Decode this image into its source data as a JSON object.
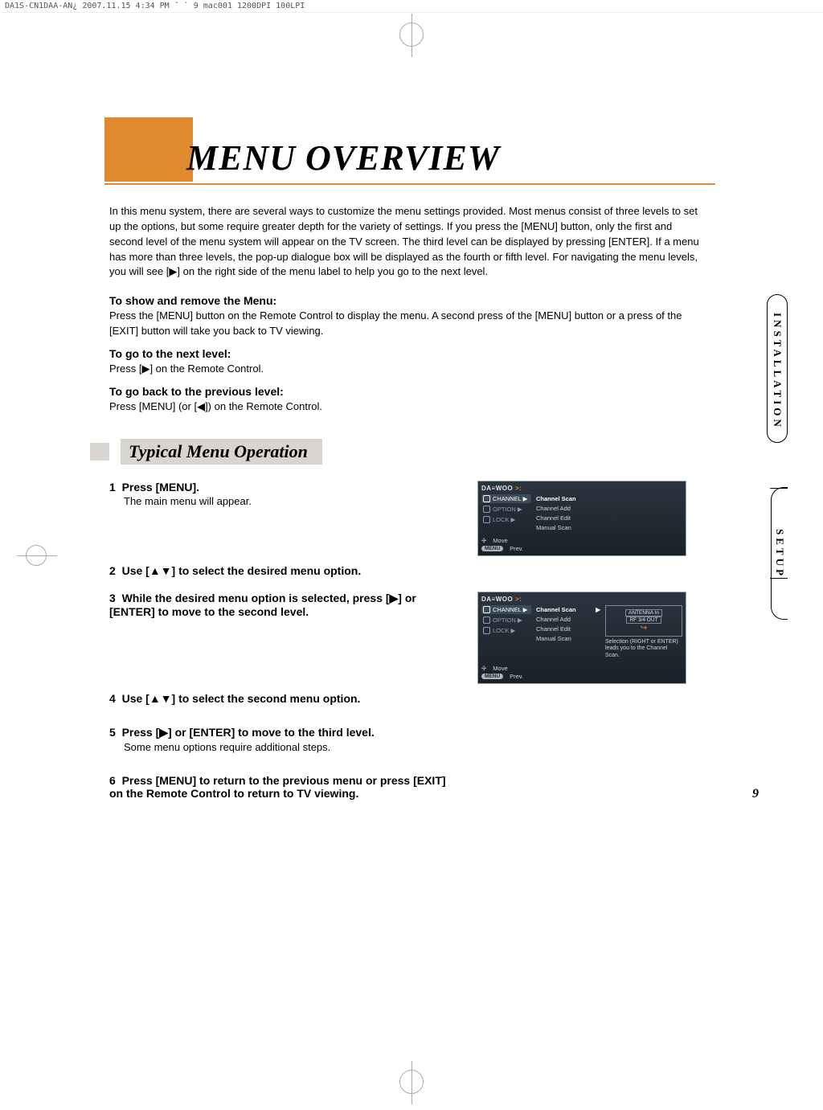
{
  "topstrip": "DA1S-CN1DAA-AN¿   2007.11.15 4:34 PM  ˘ ` 9   mac001  1200DPI 100LPI",
  "title": "MENU OVERVIEW",
  "intro": "In this menu system, there are several ways to customize the menu settings provided. Most menus consist of three levels to set up the options, but some require greater depth for the variety of settings. If you press the [MENU] button, only the first and second level of the menu system will appear on the TV screen. The third level can be displayed by pressing [ENTER]. If a menu has more than three levels, the pop-up dialogue box will be displayed as the fourth or fifth level. For navigating the menu levels, you will see [▶] on the right side of the menu label to help you go to the next level.",
  "sections": {
    "show_remove_head": "To show and remove the Menu:",
    "show_remove_body": "Press the [MENU] button on the Remote Control to display the menu. A second press of the [MENU] button or a press of the [EXIT] button will take you back to TV viewing.",
    "next_head": "To go to the next level:",
    "next_body": "Press [▶] on the Remote Control.",
    "prev_head": "To go back to the previous level:",
    "prev_body": "Press [MENU] (or [◀]) on the Remote Control."
  },
  "typical_title": "Typical Menu Operation",
  "steps": {
    "s1_num": "1",
    "s1_lead": "Press [MENU].",
    "s1_sub": "The main menu will appear.",
    "s2_num": "2",
    "s2_lead": "Use [▲▼] to select the desired menu option.",
    "s3_num": "3",
    "s3_lead": "While the desired menu option is selected, press [▶] or [ENTER] to move to the second level.",
    "s4_num": "4",
    "s4_lead": "Use [▲▼] to select the second menu option.",
    "s5_num": "5",
    "s5_lead": "Press [▶] or [ENTER] to move to the third level.",
    "s5_sub": "Some menu options require additional steps.",
    "s6_num": "6",
    "s6_lead": "Press [MENU] to return to the previous menu or press [EXIT] on the Remote Control to return to TV viewing."
  },
  "screen": {
    "brand_pre": "DA≡WOO",
    "brand_hi": ">:",
    "side": {
      "channel": "CHANNEL ▶",
      "option": "OPTION  ▶",
      "lock": "LOCK    ▶"
    },
    "mid": {
      "scan": "Channel Scan",
      "add": "Channel Add",
      "edit": "Channel Edit",
      "manual": "Manual Scan"
    },
    "arrow": "▶",
    "preview": {
      "antenna": "ANTENNA In",
      "rf": "RF 3/4 OUT"
    },
    "hint": "Selection (RIGHT or ENTER) leads you to the Channel Scan.",
    "foot_move_glyph": "✢",
    "foot_move": "Move",
    "foot_prev_pill": "MENU",
    "foot_prev": "Prev."
  },
  "tabs": {
    "install": "INSTALLATION",
    "setup": "SETUP"
  },
  "page_num": "9"
}
